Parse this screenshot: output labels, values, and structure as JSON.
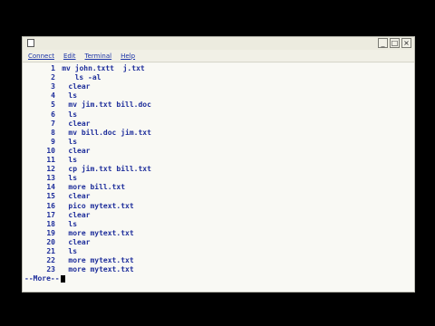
{
  "menu": {
    "items": [
      {
        "label": "Connect"
      },
      {
        "label": "Edit"
      },
      {
        "label": "Terminal"
      },
      {
        "label": "Help"
      }
    ]
  },
  "window_controls": {
    "minimize": "_",
    "maximize": "□",
    "close": "×"
  },
  "terminal": {
    "lines": [
      {
        "num": "1",
        "indent": 1,
        "cmd": "mv john.txtt  j.txt"
      },
      {
        "num": "2",
        "indent": 3,
        "cmd": "ls -al"
      },
      {
        "num": "3",
        "indent": 2,
        "cmd": "clear"
      },
      {
        "num": "4",
        "indent": 2,
        "cmd": "ls"
      },
      {
        "num": "5",
        "indent": 2,
        "cmd": "mv jim.txt bill.doc"
      },
      {
        "num": "6",
        "indent": 2,
        "cmd": "ls"
      },
      {
        "num": "7",
        "indent": 2,
        "cmd": "clear"
      },
      {
        "num": "8",
        "indent": 2,
        "cmd": "mv bill.doc jim.txt"
      },
      {
        "num": "9",
        "indent": 2,
        "cmd": "ls"
      },
      {
        "num": "10",
        "indent": 2,
        "cmd": "clear"
      },
      {
        "num": "11",
        "indent": 2,
        "cmd": "ls"
      },
      {
        "num": "12",
        "indent": 2,
        "cmd": "cp jim.txt bill.txt"
      },
      {
        "num": "13",
        "indent": 2,
        "cmd": "ls"
      },
      {
        "num": "14",
        "indent": 2,
        "cmd": "more bill.txt"
      },
      {
        "num": "15",
        "indent": 2,
        "cmd": "clear"
      },
      {
        "num": "16",
        "indent": 2,
        "cmd": "pico mytext.txt"
      },
      {
        "num": "17",
        "indent": 2,
        "cmd": "clear"
      },
      {
        "num": "18",
        "indent": 2,
        "cmd": "ls"
      },
      {
        "num": "19",
        "indent": 2,
        "cmd": "more mytext.txt"
      },
      {
        "num": "20",
        "indent": 2,
        "cmd": "clear"
      },
      {
        "num": "21",
        "indent": 2,
        "cmd": "ls"
      },
      {
        "num": "22",
        "indent": 2,
        "cmd": "more mytext.txt"
      },
      {
        "num": "23",
        "indent": 2,
        "cmd": "more mytext.txt"
      }
    ],
    "prompt": "--More--"
  }
}
